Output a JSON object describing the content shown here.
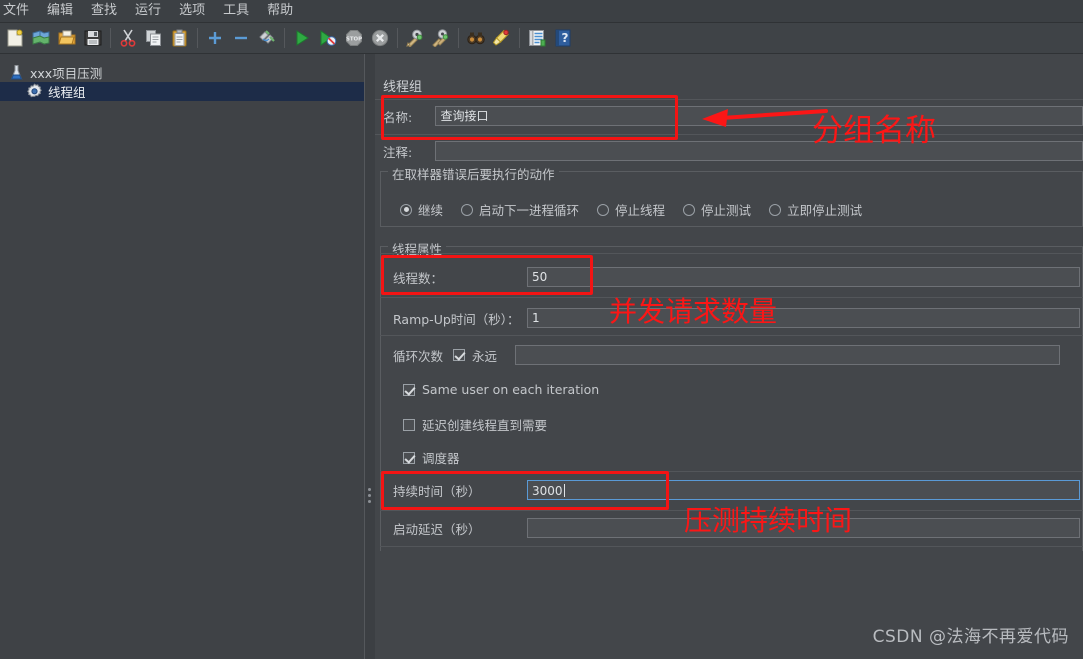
{
  "menu": {
    "items": [
      {
        "label": "文件"
      },
      {
        "label": "编辑"
      },
      {
        "label": "查找"
      },
      {
        "label": "运行"
      },
      {
        "label": "选项"
      },
      {
        "label": "工具"
      },
      {
        "label": "帮助"
      }
    ]
  },
  "toolbar": {
    "buttons": [
      {
        "name": "new-icon",
        "title": "新建"
      },
      {
        "name": "templates-icon",
        "title": "模板"
      },
      {
        "name": "open-icon",
        "title": "打开"
      },
      {
        "name": "save-icon",
        "title": "保存"
      },
      {
        "name": "cut-icon",
        "title": "剪切"
      },
      {
        "name": "copy-icon",
        "title": "复制"
      },
      {
        "name": "paste-icon",
        "title": "粘贴"
      },
      {
        "name": "expand-all-icon",
        "title": "展开全部"
      },
      {
        "name": "collapse-all-icon",
        "title": "收起全部"
      },
      {
        "name": "toggle-icon",
        "title": "启用/禁用"
      },
      {
        "name": "start-icon",
        "title": "启动"
      },
      {
        "name": "start-no-pauses-icon",
        "title": "无间隔启动"
      },
      {
        "name": "stop-icon",
        "title": "停止"
      },
      {
        "name": "shutdown-icon",
        "title": "关闭"
      },
      {
        "name": "clear-icon",
        "title": "清除"
      },
      {
        "name": "clear-all-icon",
        "title": "清除全部"
      },
      {
        "name": "search-icon",
        "title": "搜索"
      },
      {
        "name": "reset-search-icon",
        "title": "重置搜索"
      },
      {
        "name": "function-helper-icon",
        "title": "函数助手"
      },
      {
        "name": "help-icon",
        "title": "帮助"
      }
    ]
  },
  "tree": {
    "root": {
      "label": "xxx项目压测",
      "icon": "test-plan-icon"
    },
    "child": {
      "label": "线程组",
      "icon": "thread-group-icon",
      "selected": true
    }
  },
  "panel": {
    "title": "线程组",
    "name_label": "名称:",
    "name_value": "查询接口",
    "comment_label": "注释:",
    "comment_value": "",
    "error_action": {
      "legend": "在取样器错误后要执行的动作",
      "options": [
        {
          "label": "继续",
          "selected": true
        },
        {
          "label": "启动下一进程循环",
          "selected": false
        },
        {
          "label": "停止线程",
          "selected": false
        },
        {
          "label": "停止测试",
          "selected": false
        },
        {
          "label": "立即停止测试",
          "selected": false
        }
      ]
    },
    "thread_props": {
      "legend": "线程属性",
      "threads_label": "线程数：",
      "threads_value": "50",
      "rampup_label": "Ramp-Up时间（秒）：",
      "rampup_value": "1",
      "loop_label": "循环次数",
      "forever_label": "永远",
      "forever_checked": true,
      "loop_value": "",
      "same_user_label": "Same user on each iteration",
      "same_user_checked": true,
      "delay_create_label": "延迟创建线程直到需要",
      "delay_create_checked": false,
      "scheduler_label": "调度器",
      "scheduler_checked": true,
      "duration_label": "持续时间（秒）",
      "duration_value": "3000",
      "startup_delay_label": "启动延迟（秒）",
      "startup_delay_value": ""
    }
  },
  "annotations": [
    {
      "text": "分组名称"
    },
    {
      "text": "并发请求数量"
    },
    {
      "text": "压测持续时间"
    }
  ],
  "watermark": {
    "text": "CSDN @法海不再爱代码"
  },
  "colors": {
    "window_bg": "#3f4246",
    "panel_bg": "#43464a",
    "field_bg": "#4b4e52",
    "selection_bg": "#1d2c48",
    "annotation_red": "#fb1616",
    "focus_border": "#5a9ad6"
  }
}
